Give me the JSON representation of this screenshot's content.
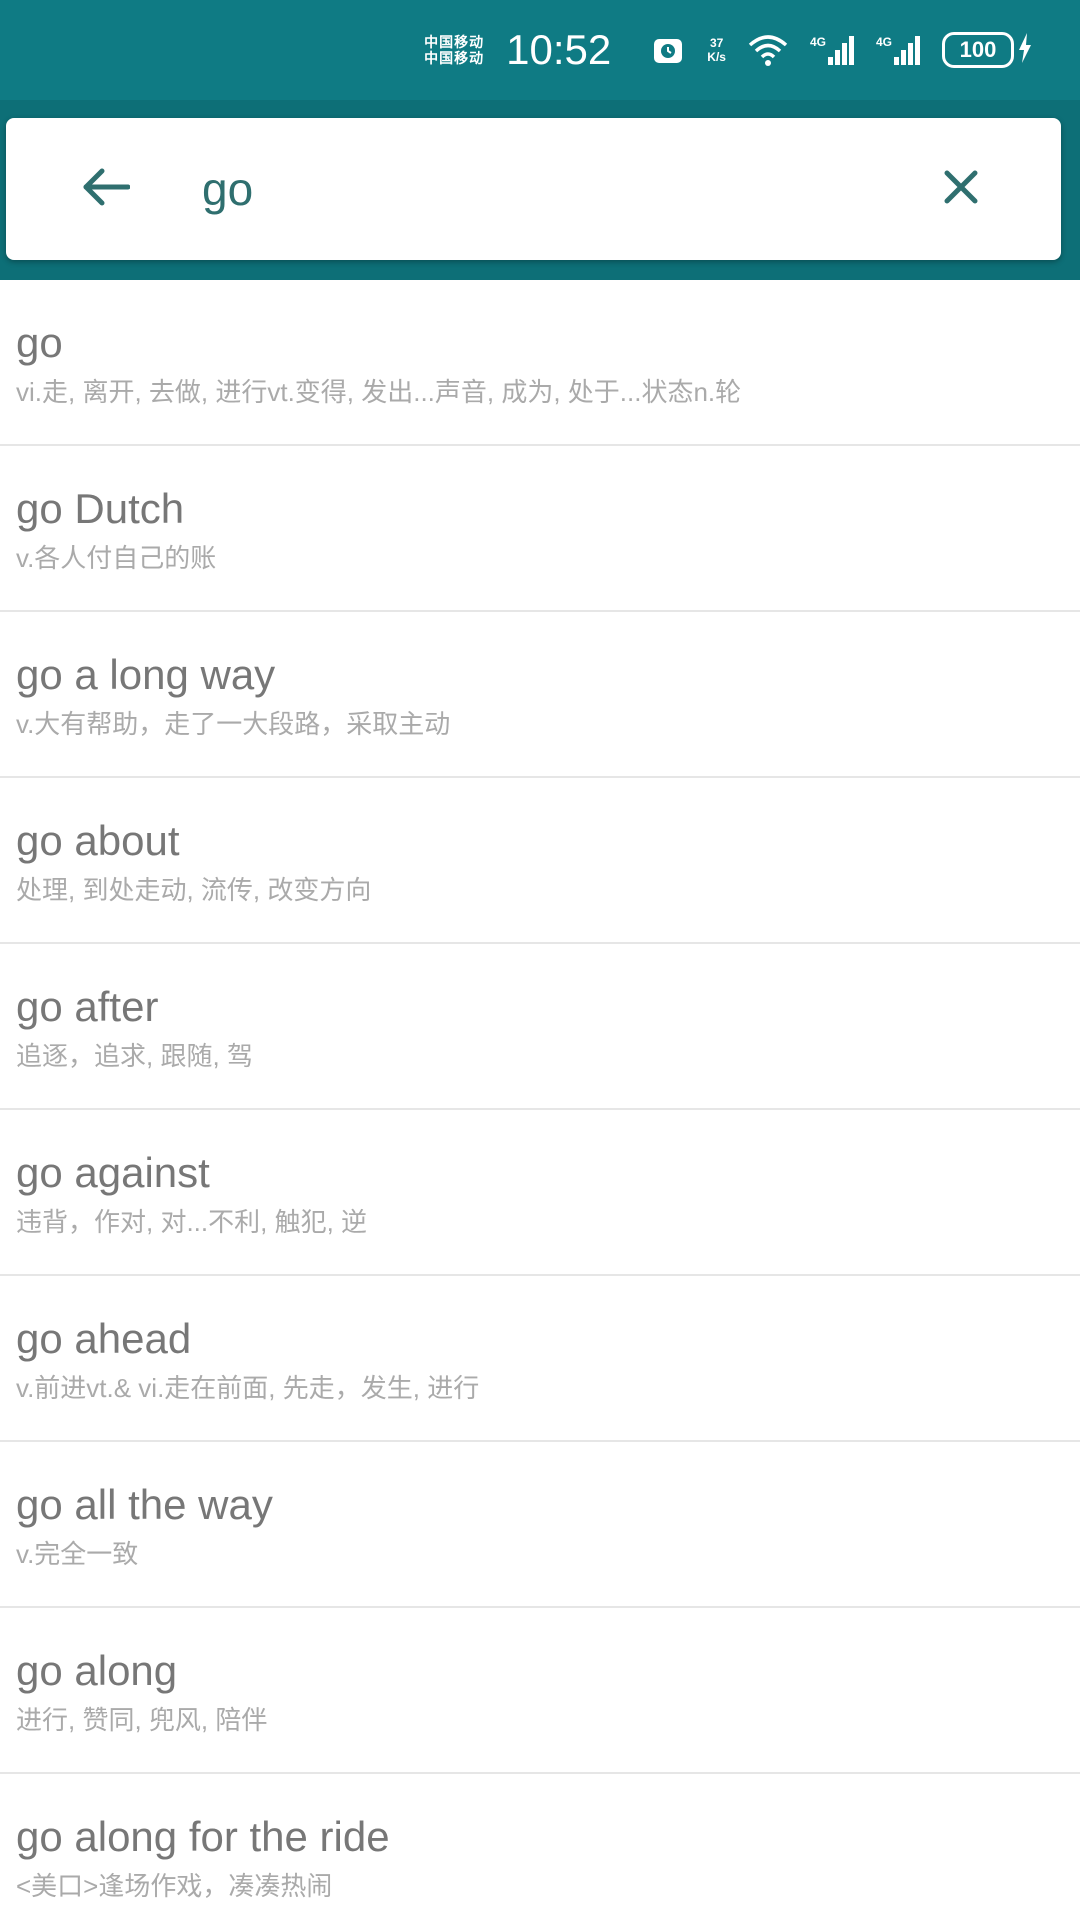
{
  "status_bar": {
    "carrier_1": "中国移动",
    "carrier_2": "中国移动",
    "time": "10:52",
    "network_speed_value": "37",
    "network_speed_unit": "K/s",
    "signal_1_label": "4G",
    "signal_2_label": "4G",
    "battery": "100",
    "icons": [
      "alarm-icon",
      "wifi-icon",
      "signal-icon",
      "signal-icon",
      "battery-icon",
      "charging-icon"
    ],
    "background_color": "#0f7b84"
  },
  "search": {
    "query": "go",
    "placeholder": "",
    "back_icon": "arrow-left-icon",
    "clear_icon": "close-icon",
    "accent_color": "#0d6f77"
  },
  "results": [
    {
      "word": "go",
      "definition": "vi.走, 离开, 去做, 进行vt.变得, 发出...声音, 成为, 处于...状态n.轮"
    },
    {
      "word": "go Dutch",
      "definition": "v.各人付自己的账"
    },
    {
      "word": "go a long way",
      "definition": "v.大有帮助，走了一大段路，采取主动"
    },
    {
      "word": "go about",
      "definition": "处理, 到处走动, 流传, 改变方向"
    },
    {
      "word": "go after",
      "definition": "追逐，追求, 跟随, 驾"
    },
    {
      "word": "go against",
      "definition": "违背，作对, 对...不利, 触犯, 逆"
    },
    {
      "word": "go ahead",
      "definition": "v.前进vt.& vi.走在前面, 先走，发生, 进行"
    },
    {
      "word": "go all the way",
      "definition": "v.完全一致"
    },
    {
      "word": "go along",
      "definition": "进行, 赞同, 兜风, 陪伴"
    },
    {
      "word": "go along for the ride",
      "definition": "<美口>逢场作戏，凑凑热闹"
    }
  ]
}
